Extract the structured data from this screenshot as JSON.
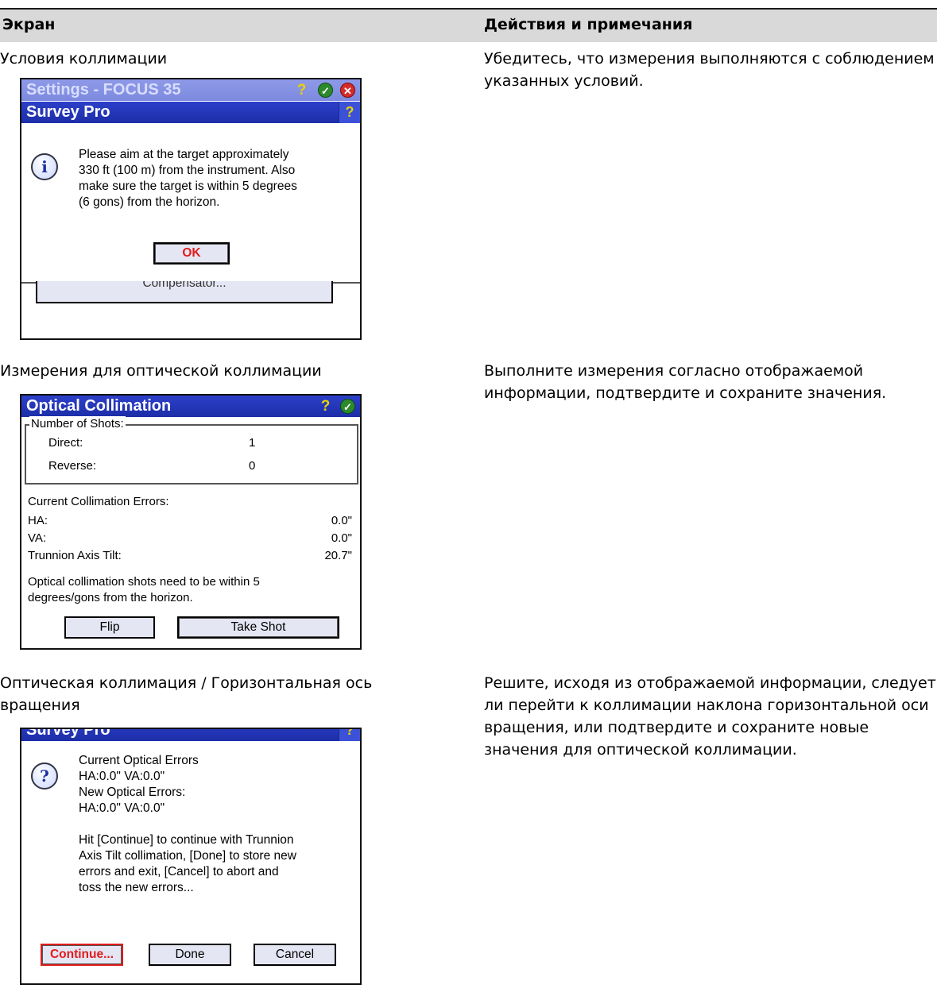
{
  "header": {
    "col1": "Экран",
    "col2": "Действия и примечания"
  },
  "rows": [
    {
      "label": "Условия коллимации",
      "note": "Убедитесь, что измерения выполняются с соблюдением указанных условий."
    },
    {
      "label": "Измерения для оптической коллимации",
      "note": "Выполните измерения согласно отображаемой информации, подтвердите и сохраните значения."
    },
    {
      "label": "Оптическая коллимация / Горизонтальная ось вращения",
      "note": "Решите, исходя из отображаемой информации, следует ли перейти к коллимации наклона горизонтальной оси вращения, или подтвердите и сохраните новые значения для оптической коллимации."
    }
  ],
  "screen1": {
    "bg_title": "Settings - FOCUS 35",
    "dialog_title": "Survey Pro",
    "message": "Please aim at the target approximately\n330 ft (100 m) from the instrument.  Also\nmake sure the target is within 5 degrees\n(6 gons) from the horizon.",
    "ok_label": "OK",
    "bg_button": "Compensator..."
  },
  "screen2": {
    "title": "Optical Collimation",
    "group_title": "Number of Shots:",
    "direct_label": "Direct:",
    "direct_value": "1",
    "reverse_label": "Reverse:",
    "reverse_value": "0",
    "errors_title": "Current Collimation Errors:",
    "ha_label": "HA:",
    "ha_value": "0.0\"",
    "va_label": "VA:",
    "va_value": "0.0\"",
    "tilt_label": "Trunnion Axis Tilt:",
    "tilt_value": "20.7\"",
    "hint": "Optical collimation shots need to be within 5\ndegrees/gons from the horizon.",
    "flip_label": "Flip",
    "shot_label": "Take Shot"
  },
  "screen3": {
    "dialog_title": "Survey Pro",
    "message": "Current Optical Errors\nHA:0.0\"  VA:0.0\"\nNew Optical Errors:\nHA:0.0\"  VA:0.0\"\n\nHit [Continue] to continue with Trunnion\nAxis Tilt collimation,  [Done] to store new\nerrors and exit, [Cancel] to abort and\ntoss the new errors...",
    "continue_label": "Continue...",
    "done_label": "Done",
    "cancel_label": "Cancel"
  }
}
